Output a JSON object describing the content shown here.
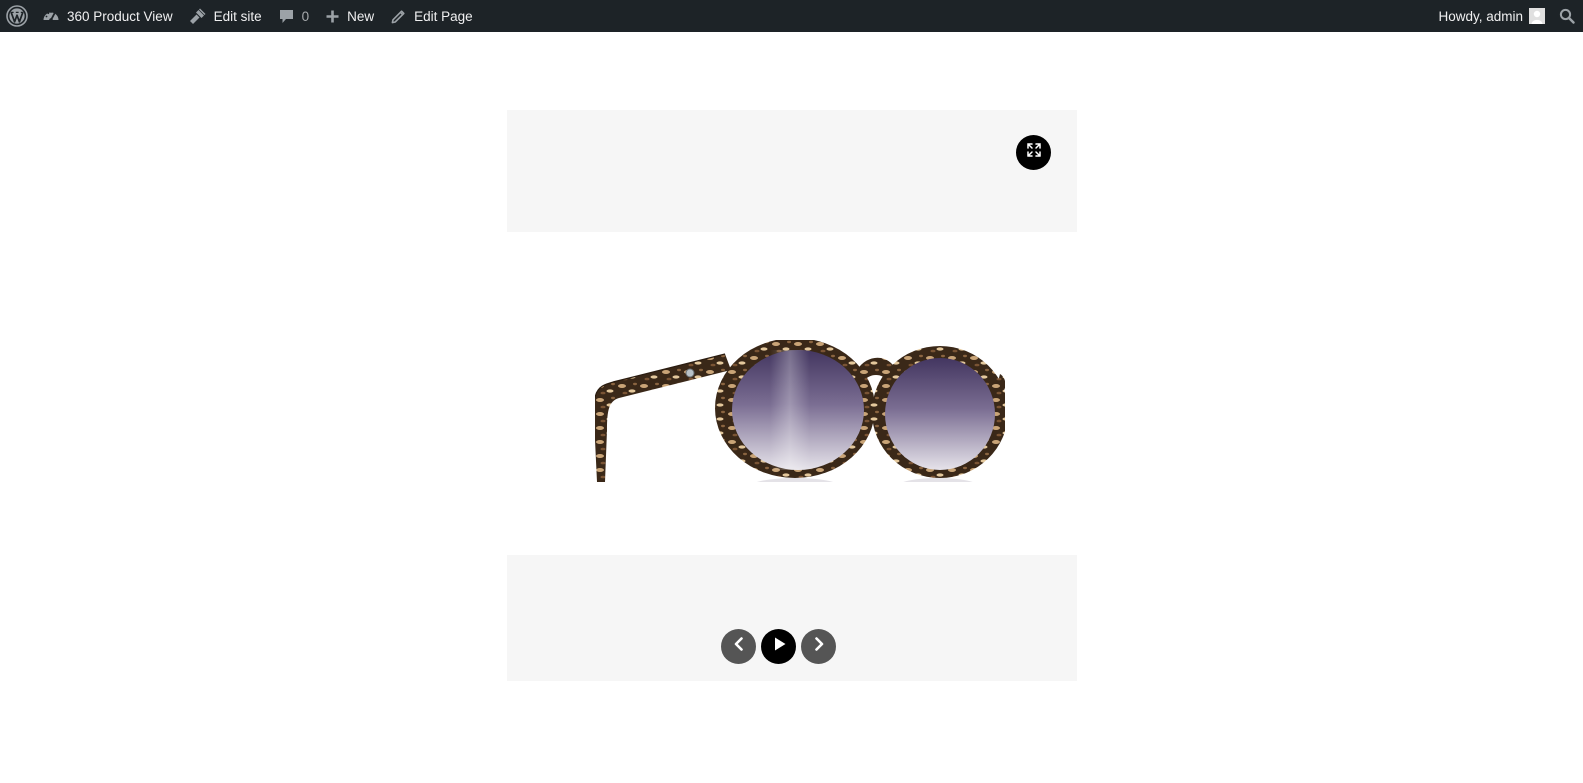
{
  "adminbar": {
    "site_name": "360 Product View",
    "edit_site": "Edit site",
    "comments_count": "0",
    "new_label": "New",
    "edit_page": "Edit Page",
    "greeting": "Howdy, admin"
  },
  "icons": {
    "wordpress": "wordpress-logo-icon",
    "dashboard": "dashboard-icon",
    "edit_site": "brush-icon",
    "comments": "comment-bubble-icon",
    "new": "plus-icon",
    "edit": "pencil-icon",
    "avatar": "user-avatar",
    "search": "search-icon",
    "fullscreen": "fullscreen-expand-icon",
    "prev": "chevron-left-icon",
    "play": "play-icon",
    "next": "chevron-right-icon"
  },
  "colors": {
    "adminbar_bg": "#1d2327",
    "viewer_panel_bg": "#f6f6f6",
    "control_bg": "#555555",
    "play_bg": "#000000"
  },
  "viewer": {
    "product": "sunglasses"
  }
}
